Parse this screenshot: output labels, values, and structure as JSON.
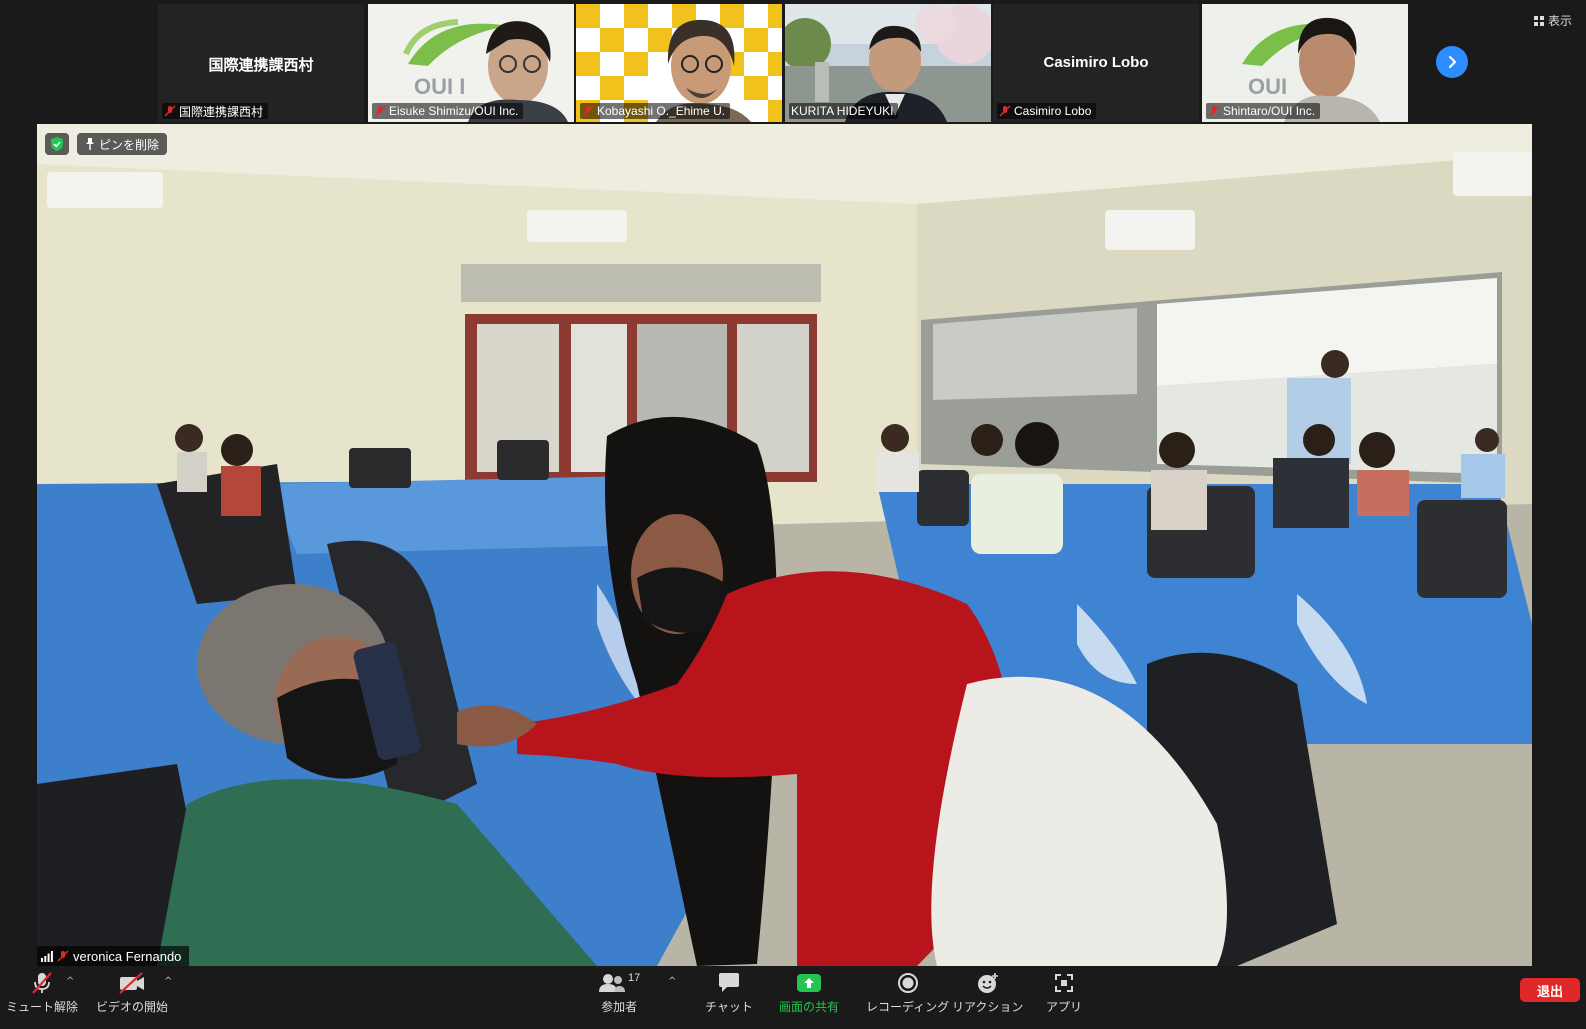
{
  "gallery": {
    "tiles": [
      {
        "display": "国際連携課西村",
        "caption": "国際連携課西村",
        "muted": true,
        "video": false
      },
      {
        "caption": "Eisuke Shimizu/OUI Inc.",
        "muted": true,
        "video": true,
        "background_text": "OUI I"
      },
      {
        "caption": "Kobayashi O._Ehime U.",
        "muted": true,
        "video": true
      },
      {
        "caption": "KURITA HIDEYUKI",
        "muted": false,
        "video": true
      },
      {
        "display": "Casimiro Lobo",
        "caption": "Casimiro Lobo",
        "muted": true,
        "video": false
      },
      {
        "caption": "Shintaro/OUI Inc.",
        "muted": true,
        "video": true,
        "background_text": "OUI"
      }
    ],
    "next_page_icon": "chevron-right-icon",
    "view_label": "表示"
  },
  "main_video": {
    "unpin_label": "ピンを削除",
    "speaker_name": "veronica Fernando",
    "speaker_muted": true
  },
  "toolbar": {
    "mute_label": "ミュート解除",
    "video_label": "ビデオの開始",
    "participants_label": "参加者",
    "participants_count": "17",
    "chat_label": "チャット",
    "share_label": "画面の共有",
    "record_label": "レコーディング",
    "reactions_label": "リアクション",
    "apps_label": "アプリ",
    "leave_label": "退出"
  },
  "colors": {
    "accent_blue": "#2d8cff",
    "share_green": "#23c552",
    "leave_red": "#e02828",
    "muted_red": "#e02828",
    "background": "#1a1a1a"
  }
}
